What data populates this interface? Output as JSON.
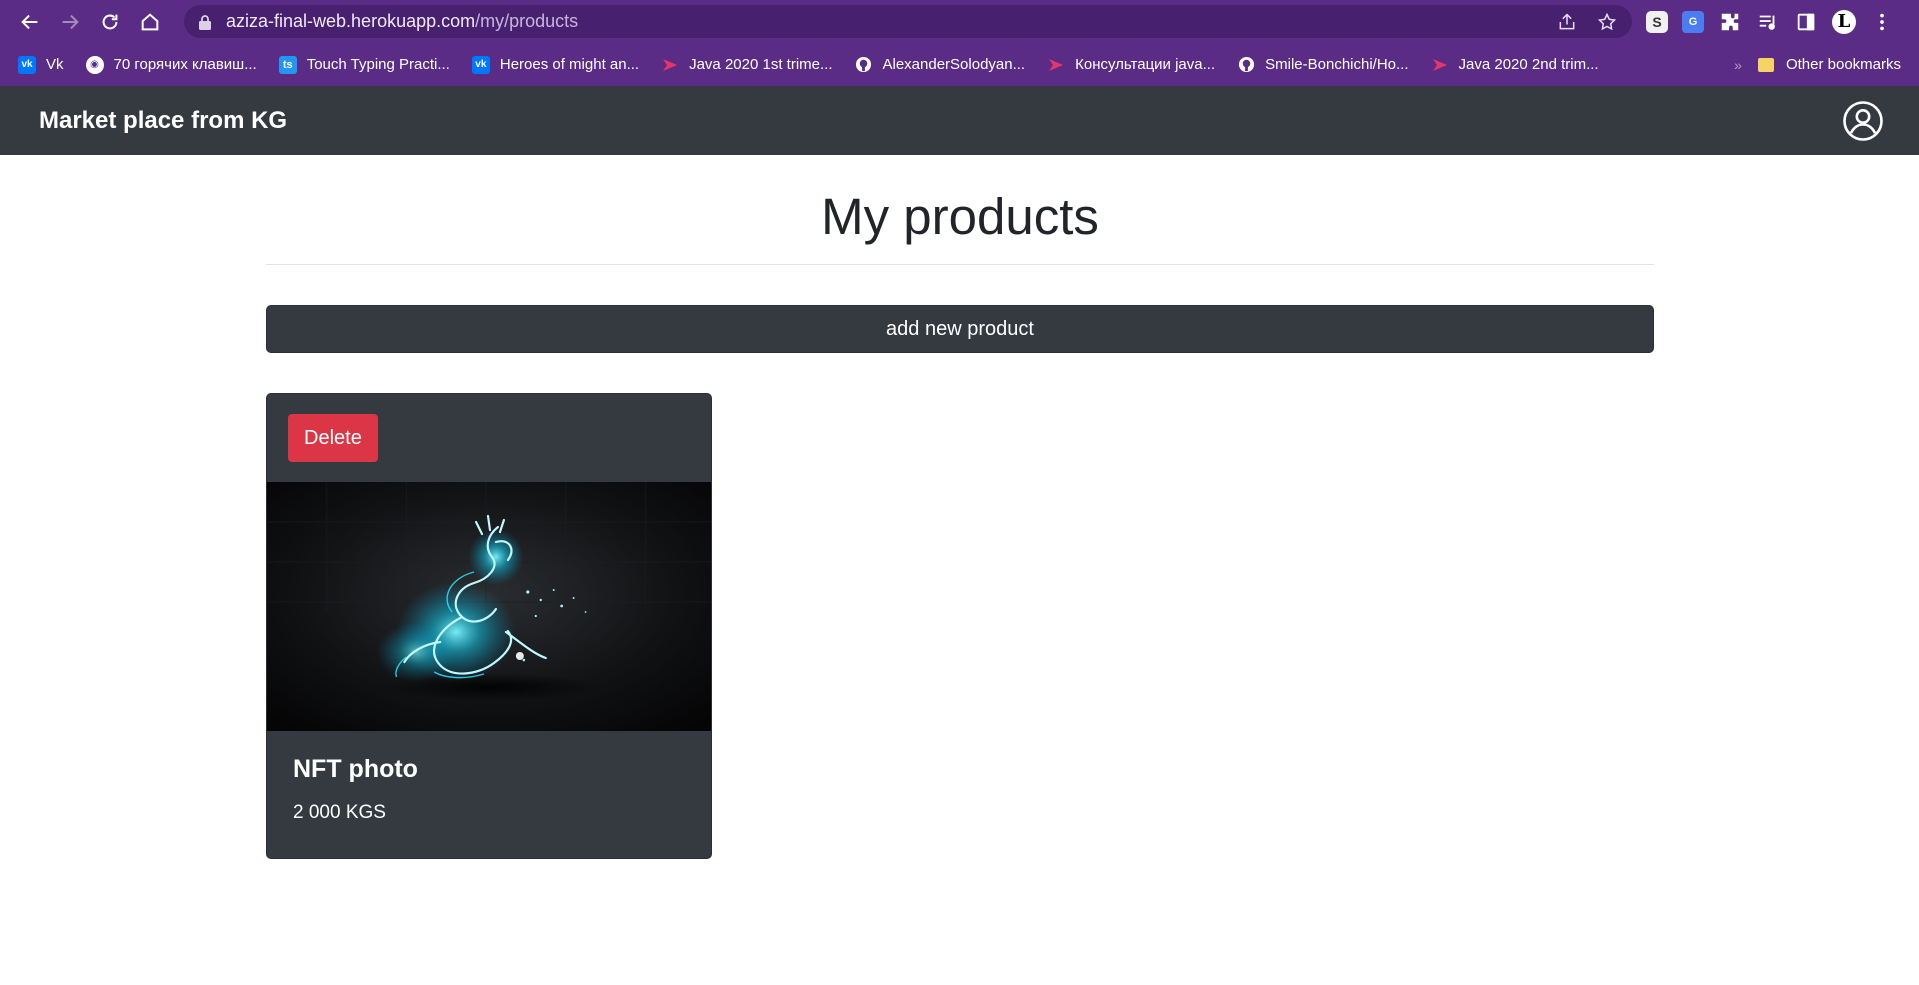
{
  "browser": {
    "url_host": "aziza-final-web.herokuapp.com",
    "url_path": "/my/products",
    "bookmarks": [
      {
        "label": "Vk",
        "icon": "vk-icon"
      },
      {
        "label": "70 горячих клавиш...",
        "icon": "globe-icon"
      },
      {
        "label": "Touch Typing Practi...",
        "icon": "ts-icon"
      },
      {
        "label": "Heroes of might an...",
        "icon": "vk-icon"
      },
      {
        "label": "Java 2020 1st trime...",
        "icon": "java-icon"
      },
      {
        "label": "AlexanderSolodyan...",
        "icon": "github-icon"
      },
      {
        "label": "Консультации java...",
        "icon": "java-icon"
      },
      {
        "label": "Smile-Bonchichi/Ho...",
        "icon": "github-icon"
      },
      {
        "label": "Java 2020 2nd trim...",
        "icon": "java-icon"
      }
    ],
    "other_bookmarks": "Other bookmarks",
    "extensions": {
      "s": "S",
      "gt": "G",
      "avatar": "L"
    }
  },
  "navbar": {
    "brand": "Market place from KG"
  },
  "main": {
    "title": "My products",
    "add_button": "add new product"
  },
  "products": [
    {
      "delete_label": "Delete",
      "name": "NFT photo",
      "price": "2 000 KGS"
    }
  ],
  "colors": {
    "chrome": "#5b2c86",
    "navbar": "#343a40",
    "danger": "#dc3545",
    "accent_glow": "#2ee6ff"
  }
}
